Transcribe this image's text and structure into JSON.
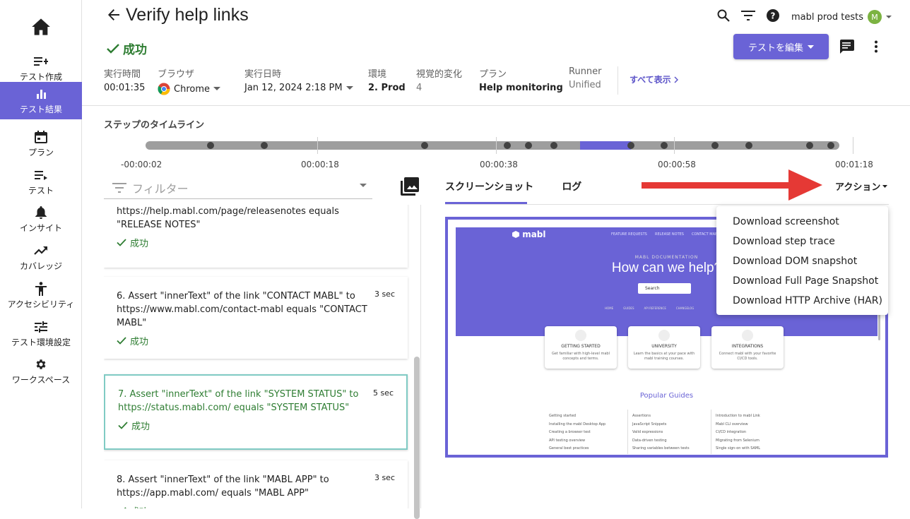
{
  "sidebar": {
    "home_icon": "home-icon",
    "items": [
      {
        "label": "テスト作成",
        "icon": "playlist-add-icon"
      },
      {
        "label": "テスト結果",
        "icon": "bar-chart-icon",
        "active": true
      },
      {
        "label": "プラン",
        "icon": "calendar-icon"
      },
      {
        "label": "テスト",
        "icon": "list-icon"
      },
      {
        "label": "インサイト",
        "icon": "bell-icon"
      },
      {
        "label": "カバレッジ",
        "icon": "trending-up-icon"
      },
      {
        "label": "アクセシビリティ",
        "icon": "accessibility-icon"
      },
      {
        "label": "テスト環境設定",
        "icon": "tune-icon"
      },
      {
        "label": "ワークスペース",
        "icon": "gear-icon"
      }
    ],
    "accent": "#6a63d6"
  },
  "header": {
    "title": "Verify help links",
    "status": "成功",
    "user": "mabl prod tests",
    "avatar_initial": "M",
    "edit_button": "テストを編集",
    "show_all": "すべて表示",
    "meta": [
      {
        "label": "実行時間",
        "value": "00:01:35"
      },
      {
        "label": "ブラウザ",
        "value": "Chrome"
      },
      {
        "label": "実行日時",
        "value": "Jan 12, 2024 2:18 PM"
      },
      {
        "label": "環境",
        "value": "2. Prod"
      },
      {
        "label": "視覚的変化",
        "value": "4"
      },
      {
        "label": "プラン",
        "value": "Help monitoring"
      },
      {
        "label": "Runner",
        "value": "Unified"
      }
    ]
  },
  "timeline": {
    "title": "ステップのタイムライン",
    "labels": [
      "-00:00:02",
      "00:00:18",
      "00:00:38",
      "00:00:58",
      "00:01:18"
    ]
  },
  "filter": {
    "placeholder": "フィルター"
  },
  "steps": [
    {
      "text": "https://help.mabl.com/page/releasenotes equals \"RELEASE NOTES\"",
      "status": "成功",
      "duration": ""
    },
    {
      "text": "6. Assert \"innerText\" of the link \"CONTACT MABL\" to https://www.mabl.com/contact-mabl equals \"CONTACT MABL\"",
      "status": "成功",
      "duration": "3 sec"
    },
    {
      "text": "7. Assert \"innerText\" of the link \"SYSTEM STATUS\" to https://status.mabl.com/ equals \"SYSTEM STATUS\"",
      "status": "成功",
      "duration": "5 sec"
    },
    {
      "text": "8. Assert \"innerText\" of the link \"MABL APP\" to https://app.mabl.com/ equals \"MABL APP\"",
      "status": "成功",
      "duration": "3 sec"
    }
  ],
  "tabs": {
    "screenshot": "スクリーンショット",
    "log": "ログ",
    "actions": "アクション"
  },
  "menu": [
    "Download screenshot",
    "Download step trace",
    "Download DOM snapshot",
    "Download Full Page Snapshot",
    "Download HTTP Archive (HAR)"
  ],
  "screenshot": {
    "logo": "mabl",
    "nav": [
      "FEATURE REQUESTS",
      "RELEASE NOTES",
      "CONTACT MABL"
    ],
    "doc": "MABL DOCUMENTATION",
    "headline": "How can we help?",
    "search": "Search",
    "mini_tabs": [
      "HOME",
      "GUIDES",
      "API REFERENCE",
      "CHANGELOG"
    ],
    "cards": [
      {
        "title": "GETTING STARTED",
        "desc": "Get familiar with high-level mabl concepts and terms."
      },
      {
        "title": "UNIVERSITY",
        "desc": "Learn the basics at your pace with mabl training courses."
      },
      {
        "title": "INTEGRATIONS",
        "desc": "Connect mabl with your favorite CI/CD tools."
      }
    ],
    "popular": "Popular Guides",
    "guides_col1": [
      "Getting started",
      "Installing the mabl Desktop App",
      "Creating a browser test",
      "API testing overview",
      "General best practices"
    ],
    "guides_col2": [
      "Assertions",
      "JavaScript Snippets",
      "Valid expressions",
      "Data-driven testing",
      "Sharing variables between tests"
    ],
    "guides_col3": [
      "Introduction to mabl Link",
      "Mabl CLI overview",
      "CI/CD integration",
      "Migrating from Selenium",
      "Single sign-on with SAML"
    ]
  },
  "colors": {
    "accent": "#6a63d6",
    "success": "#2e7d32",
    "arrow": "#e53935"
  }
}
